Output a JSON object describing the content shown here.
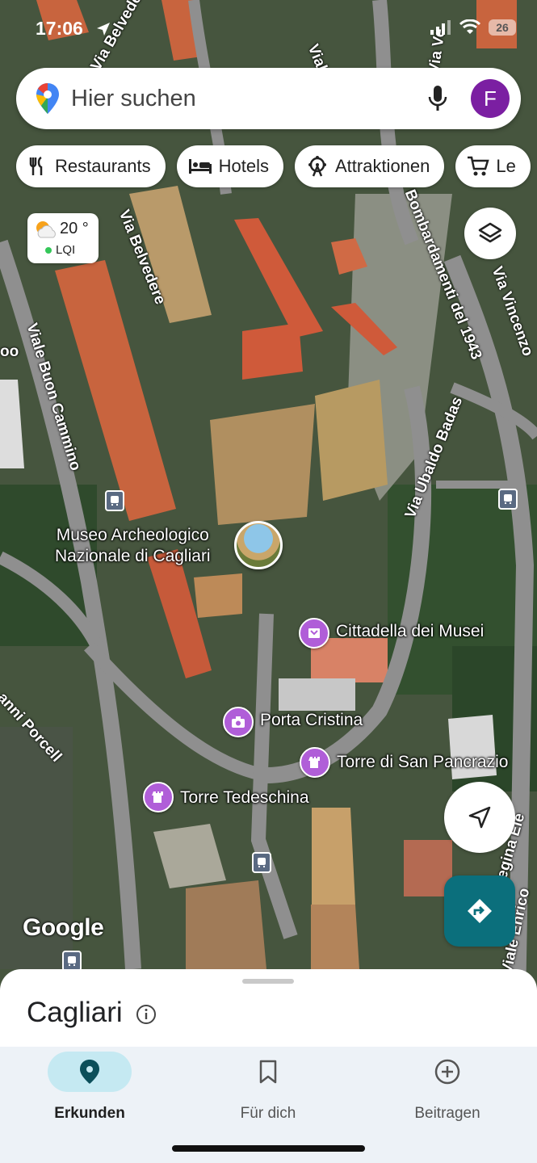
{
  "status_bar": {
    "time": "17:06",
    "battery": "26"
  },
  "search": {
    "placeholder": "Hier suchen",
    "avatar_initial": "F"
  },
  "chips": [
    "Restaurants",
    "Hotels",
    "Attraktionen",
    "Le"
  ],
  "weather": {
    "temperature": "20 °",
    "aqi_label": "LQI"
  },
  "map": {
    "streets": [
      "Viale Buon Cammino",
      "Via Belvedere",
      "Via Belvedere",
      "Viale",
      "Via Ve",
      "Via Ubaldo Badas",
      "Bombardamenti del 1943",
      "Via Vincenzo",
      "anni Porcell",
      "Regina Ele",
      "Viale Enrico",
      "oo"
    ],
    "pois": [
      {
        "name": "Museo Archeologico",
        "name2": "Nazionale di Cagliari"
      },
      {
        "name": "Cittadella dei Musei"
      },
      {
        "name": "Porta Cristina"
      },
      {
        "name": "Torre di San Pancrazio"
      },
      {
        "name": "Torre Tedeschina"
      }
    ],
    "attribution": "Google"
  },
  "sheet": {
    "title": "Cagliari"
  },
  "nav": [
    {
      "label": "Erkunden",
      "active": true
    },
    {
      "label": "Für dich",
      "active": false
    },
    {
      "label": "Beitragen",
      "active": false
    }
  ],
  "colors": {
    "accent_teal": "#0b6f7c",
    "avatar_purple": "#7b1fa2",
    "poi_purple": "#b05ed8",
    "nav_active": "#c5e9f2"
  }
}
